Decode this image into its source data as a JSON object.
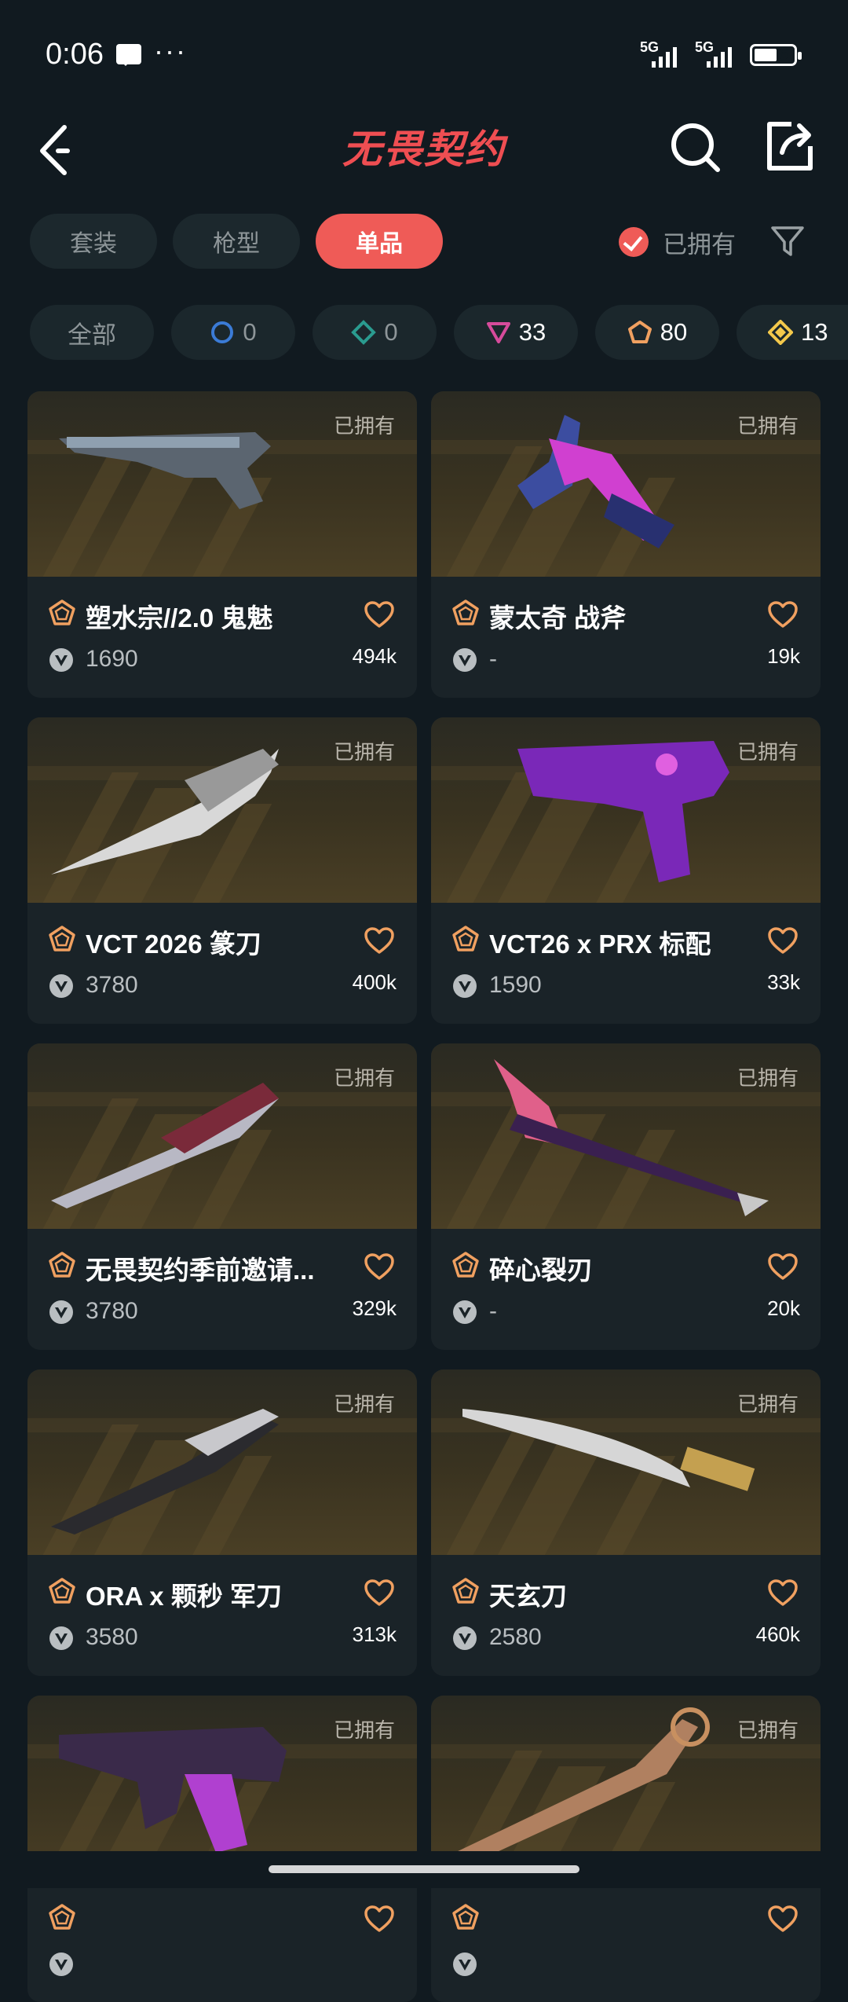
{
  "status_bar": {
    "time": "0:06",
    "network_1": "5G",
    "network_2": "5G",
    "battery": "6"
  },
  "header": {
    "title": "无畏契约"
  },
  "tabs": [
    {
      "label": "套装",
      "active": false
    },
    {
      "label": "枪型",
      "active": false
    },
    {
      "label": "单品",
      "active": true
    }
  ],
  "owned_filter": {
    "label": "已拥有",
    "checked": true
  },
  "tier_filters": [
    {
      "label": "全部"
    },
    {
      "icon": "select-tier-icon",
      "count": "0",
      "color": "#3b7bd6"
    },
    {
      "icon": "deluxe-tier-icon",
      "count": "0",
      "color": "#2a9b8f"
    },
    {
      "icon": "premium-tier-icon",
      "count": "33",
      "color": "#d64b9b"
    },
    {
      "icon": "exclusive-tier-icon",
      "count": "80",
      "color": "#f0a060"
    },
    {
      "icon": "ultra-tier-icon",
      "count": "13",
      "color": "#f3c84b"
    }
  ],
  "items": [
    {
      "name": "塑水宗//2.0 鬼魅",
      "price": "1690",
      "likes": "494k",
      "owned_label": "已拥有"
    },
    {
      "name": "蒙太奇 战斧",
      "price": "-",
      "likes": "19k",
      "owned_label": "已拥有"
    },
    {
      "name": "VCT 2026 篆刀",
      "price": "3780",
      "likes": "400k",
      "owned_label": "已拥有"
    },
    {
      "name": "VCT26 x PRX 标配",
      "price": "1590",
      "likes": "33k",
      "owned_label": "已拥有"
    },
    {
      "name": "无畏契约季前邀请...",
      "price": "3780",
      "likes": "329k",
      "owned_label": "已拥有"
    },
    {
      "name": "碎心裂刃",
      "price": "-",
      "likes": "20k",
      "owned_label": "已拥有"
    },
    {
      "name": "ORA x 颗秒 军刀",
      "price": "3580",
      "likes": "313k",
      "owned_label": "已拥有"
    },
    {
      "name": "天玄刀",
      "price": "2580",
      "likes": "460k",
      "owned_label": "已拥有"
    },
    {
      "name": "",
      "price": "",
      "likes": "",
      "owned_label": "已拥有"
    },
    {
      "name": "",
      "price": "",
      "likes": "",
      "owned_label": "已拥有"
    }
  ],
  "colors": {
    "accent": "#ef5b57",
    "tier_exclusive": "#f0a060",
    "background": "#111a20"
  }
}
